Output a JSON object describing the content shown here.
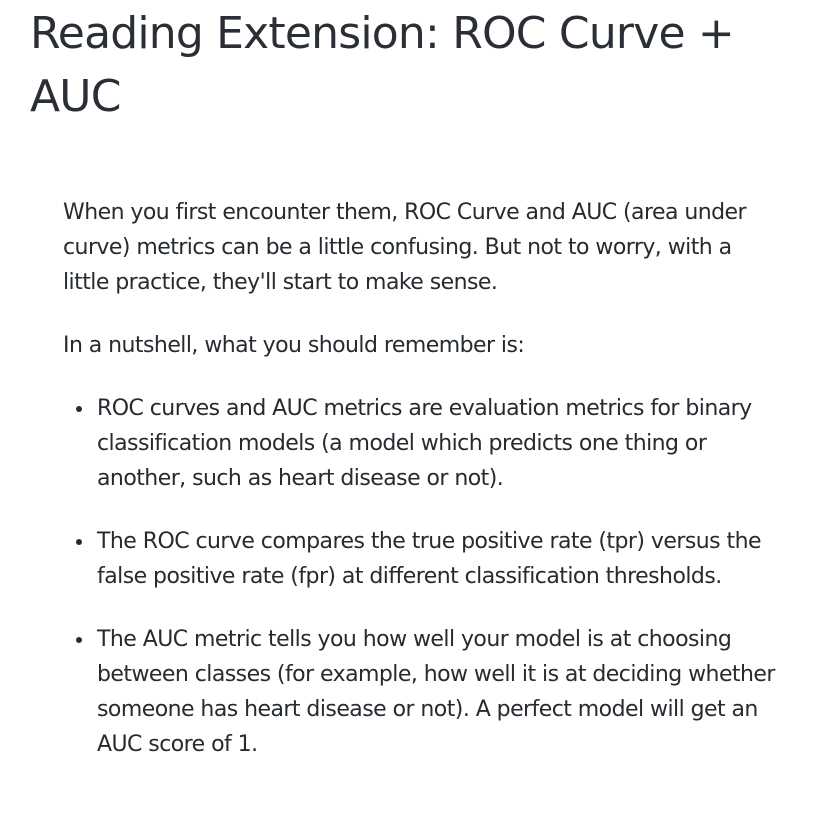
{
  "title": "Reading Extension: ROC Curve + AUC",
  "paragraphs": [
    "When you first encounter them, ROC Curve and AUC (area under curve) metrics can be a little confusing. But not to worry, with a little practice, they'll start to make sense.",
    "In a nutshell, what you should remember is:"
  ],
  "bullets": [
    "ROC curves and AUC metrics are evaluation metrics for binary classification models (a model which predicts one thing or another, such as heart disease or not).",
    "The ROC curve compares the true positive rate (tpr) versus the false positive rate (fpr) at different classification thresholds.",
    "The AUC metric tells you how well your model is at choosing between classes (for example, how well it is at deciding whether someone has heart disease or not). A perfect model will get an AUC score of 1."
  ]
}
